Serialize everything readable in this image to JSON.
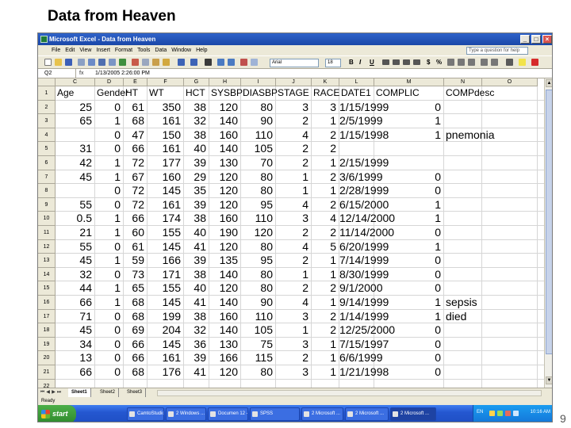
{
  "slide": {
    "title": "Data from Heaven",
    "page_number": "9"
  },
  "window": {
    "title": "Microsoft Excel - Data from Heaven",
    "help_placeholder": "Type a question for help"
  },
  "menus": [
    "File",
    "Edit",
    "View",
    "Insert",
    "Format",
    "Tools",
    "Data",
    "Window",
    "Help"
  ],
  "toolbar": {
    "font": "Arial",
    "size": "18",
    "bold": "B",
    "italic": "I",
    "underline": "U",
    "currency": "$",
    "percent": "%"
  },
  "formula_bar": {
    "name_box": "Q2",
    "fx": "fx",
    "content": "1/13/2005 2:26:00 PM"
  },
  "columns": [
    "C",
    "D",
    "E",
    "F",
    "G",
    "H",
    "I",
    "J",
    "K",
    "L",
    "M",
    "N",
    "O"
  ],
  "header_row": [
    "Age",
    "Gender",
    "HT",
    "WT",
    "HCT",
    "SYSBP",
    "DIASBP",
    "STAGE",
    "RACE",
    "DATE1",
    "COMPLIC",
    "COMPdesc"
  ],
  "rows": [
    {
      "num": "2",
      "cells": [
        "25",
        "0",
        "61",
        "350",
        "38",
        "120",
        "80",
        "3",
        "3",
        "1/15/1999",
        "0",
        ""
      ]
    },
    {
      "num": "3",
      "cells": [
        "65",
        "1",
        "68",
        "161",
        "32",
        "140",
        "90",
        "2",
        "1",
        "2/5/1999",
        "1",
        ""
      ]
    },
    {
      "num": "4",
      "cells": [
        "",
        "0",
        "47",
        "150",
        "38",
        "160",
        "110",
        "4",
        "2",
        "1/15/1998",
        "1",
        "pnemonia"
      ]
    },
    {
      "num": "5",
      "cells": [
        "31",
        "0",
        "66",
        "161",
        "40",
        "140",
        "105",
        "2",
        "2",
        "",
        "",
        ""
      ]
    },
    {
      "num": "6",
      "cells": [
        "42",
        "1",
        "72",
        "177",
        "39",
        "130",
        "70",
        "2",
        "1",
        "2/15/1999",
        "",
        ""
      ]
    },
    {
      "num": "7",
      "cells": [
        "45",
        "1",
        "67",
        "160",
        "29",
        "120",
        "80",
        "1",
        "2",
        "3/6/1999",
        "0",
        ""
      ]
    },
    {
      "num": "8",
      "cells": [
        "",
        "0",
        "72",
        "145",
        "35",
        "120",
        "80",
        "1",
        "1",
        "2/28/1999",
        "0",
        ""
      ]
    },
    {
      "num": "9",
      "cells": [
        "55",
        "0",
        "72",
        "161",
        "39",
        "120",
        "95",
        "4",
        "2",
        "6/15/2000",
        "1",
        ""
      ]
    },
    {
      "num": "10",
      "cells": [
        "0.5",
        "1",
        "66",
        "174",
        "38",
        "160",
        "110",
        "3",
        "4",
        "12/14/2000",
        "1",
        ""
      ]
    },
    {
      "num": "11",
      "cells": [
        "21",
        "1",
        "60",
        "155",
        "40",
        "190",
        "120",
        "2",
        "2",
        "11/14/2000",
        "0",
        ""
      ]
    },
    {
      "num": "12",
      "cells": [
        "55",
        "0",
        "61",
        "145",
        "41",
        "120",
        "80",
        "4",
        "5",
        "6/20/1999",
        "1",
        ""
      ]
    },
    {
      "num": "13",
      "cells": [
        "45",
        "1",
        "59",
        "166",
        "39",
        "135",
        "95",
        "2",
        "1",
        "7/14/1999",
        "0",
        ""
      ]
    },
    {
      "num": "14",
      "cells": [
        "32",
        "0",
        "73",
        "171",
        "38",
        "140",
        "80",
        "1",
        "1",
        "8/30/1999",
        "0",
        ""
      ]
    },
    {
      "num": "15",
      "cells": [
        "44",
        "1",
        "65",
        "155",
        "40",
        "120",
        "80",
        "2",
        "2",
        "9/1/2000",
        "0",
        ""
      ]
    },
    {
      "num": "16",
      "cells": [
        "66",
        "1",
        "68",
        "145",
        "41",
        "140",
        "90",
        "4",
        "1",
        "9/14/1999",
        "1",
        "sepsis"
      ]
    },
    {
      "num": "17",
      "cells": [
        "71",
        "0",
        "68",
        "199",
        "38",
        "160",
        "110",
        "3",
        "2",
        "1/14/1999",
        "1",
        "died"
      ]
    },
    {
      "num": "18",
      "cells": [
        "45",
        "0",
        "69",
        "204",
        "32",
        "140",
        "105",
        "1",
        "2",
        "12/25/2000",
        "0",
        ""
      ]
    },
    {
      "num": "19",
      "cells": [
        "34",
        "0",
        "66",
        "145",
        "36",
        "130",
        "75",
        "3",
        "1",
        "7/15/1997",
        "0",
        ""
      ]
    },
    {
      "num": "20",
      "cells": [
        "13",
        "0",
        "66",
        "161",
        "39",
        "166",
        "115",
        "2",
        "1",
        "6/6/1999",
        "0",
        ""
      ]
    },
    {
      "num": "21",
      "cells": [
        "66",
        "0",
        "68",
        "176",
        "41",
        "120",
        "80",
        "3",
        "1",
        "1/21/1998",
        "0",
        ""
      ]
    }
  ],
  "empty_row": "22",
  "sheet_tabs": [
    "Sheet1",
    "Sheet2",
    "Sheet3"
  ],
  "status": "Ready",
  "taskbar": {
    "start": "start",
    "tasks": [
      "CamtoStudio re...",
      "2 Windows ...",
      "Documen 12 - ...",
      "SPSS",
      "2 Microsoft ...",
      "2 Microsoft ...",
      "2 Microsoft ..."
    ],
    "lang": "EN",
    "clock": "10:16 AM"
  }
}
